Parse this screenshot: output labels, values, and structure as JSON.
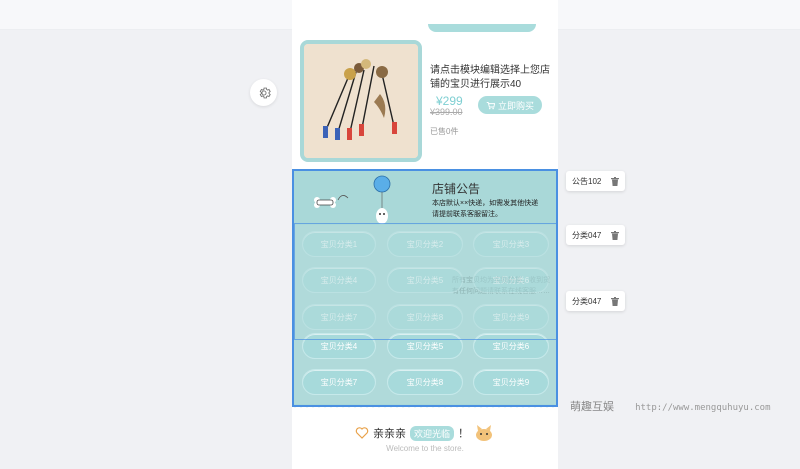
{
  "product": {
    "title": "请点击模块编辑选择上您店铺的宝贝进行展示40",
    "price": "¥299",
    "price_old": "¥399.00",
    "buy_label": "立即购买",
    "sold": "已售0件"
  },
  "notice": {
    "title": "店铺公告",
    "text": "本店默认××快递，如需发其他快递请提前联系客服留注。",
    "ghost_text": "所有宝贝均为实物拍摄，收到货有任何问题请联系在线客服……"
  },
  "category_rows": [
    [
      "宝贝分类1",
      "宝贝分类2",
      "宝贝分类3"
    ],
    [
      "宝贝分类4",
      "宝贝分类5",
      "宝贝分类6"
    ],
    [
      "宝贝分类7",
      "宝贝分类8",
      "宝贝分类9"
    ],
    [
      "宝贝分类4",
      "宝贝分类5",
      "宝贝分类6"
    ],
    [
      "宝贝分类7",
      "宝贝分类8",
      "宝贝分类9"
    ]
  ],
  "welcome": {
    "text_left": "亲亲亲",
    "tag": "欢迎光临",
    "text_right": "！",
    "sub": "Welcome to the store."
  },
  "module_chips": [
    {
      "label": "公告102"
    },
    {
      "label": "分类047"
    },
    {
      "label": "分类047"
    }
  ],
  "watermark": {
    "brand": "萌趣互娱",
    "url": "http://www.mengquhuyu.com"
  },
  "colors": {
    "accent": "#a9dcdc",
    "selection": "#4a90e2",
    "price": "#7fcfd2"
  }
}
